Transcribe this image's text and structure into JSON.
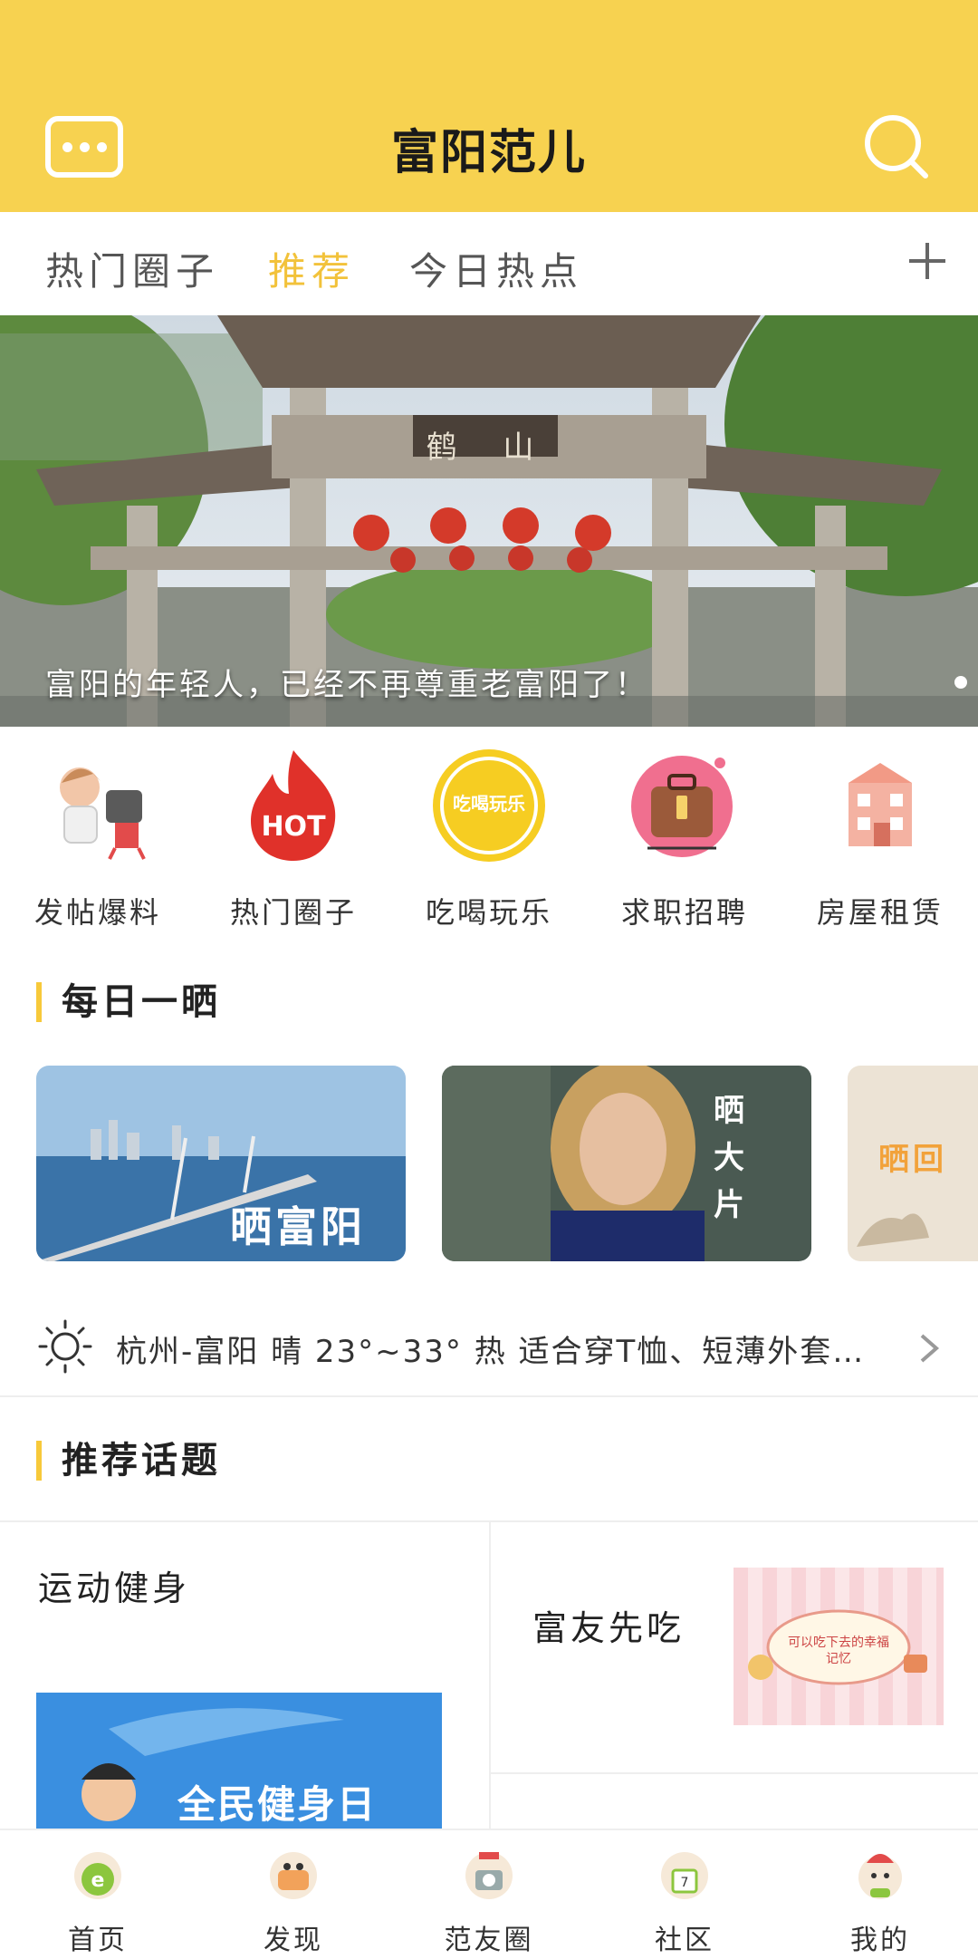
{
  "header": {
    "title": "富阳范儿",
    "menu_icon": "more-icon",
    "search_icon": "search-icon",
    "background": "#f7d250"
  },
  "tabs": [
    {
      "label": "热门圈子",
      "active": false
    },
    {
      "label": "推荐",
      "active": true
    },
    {
      "label": "今日热点",
      "active": false
    }
  ],
  "tabs_add_icon": "plus-icon",
  "banner": {
    "caption": "富阳的年轻人，已经不再尊重老富阳了！",
    "sign_text": "鹤 山"
  },
  "quick_links": [
    {
      "label": "发帖爆料",
      "icon": "post-news-icon"
    },
    {
      "label": "热门圈子",
      "icon": "hot-icon",
      "badge": "HOT"
    },
    {
      "label": "吃喝玩乐",
      "icon": "food-fun-icon",
      "badge": "吃喝玩乐"
    },
    {
      "label": "求职招聘",
      "icon": "briefcase-icon"
    },
    {
      "label": "房屋租赁",
      "icon": "house-icon"
    }
  ],
  "daily": {
    "title": "每日一晒",
    "cards": [
      {
        "text": "晒富阳"
      },
      {
        "text": "晒大片"
      },
      {
        "text": "晒回"
      }
    ]
  },
  "weather": {
    "icon": "sun-icon",
    "text": "杭州-富阳 晴 23°~33° 热 适合穿T恤、短薄外套…"
  },
  "topics": {
    "title": "推荐话题",
    "items": [
      {
        "label": "运动健身",
        "image_text": "全民健身日"
      },
      {
        "label": "富友先吃",
        "image_text": "可以吃下去的幸福记忆"
      }
    ]
  },
  "nav": [
    {
      "label": "首页",
      "icon": "home-icon"
    },
    {
      "label": "发现",
      "icon": "discover-icon"
    },
    {
      "label": "范友圈",
      "icon": "friends-circle-icon"
    },
    {
      "label": "社区",
      "icon": "community-icon"
    },
    {
      "label": "我的",
      "icon": "profile-icon"
    }
  ],
  "colors": {
    "accent": "#f7d250",
    "tab_active": "#f2c23a"
  }
}
